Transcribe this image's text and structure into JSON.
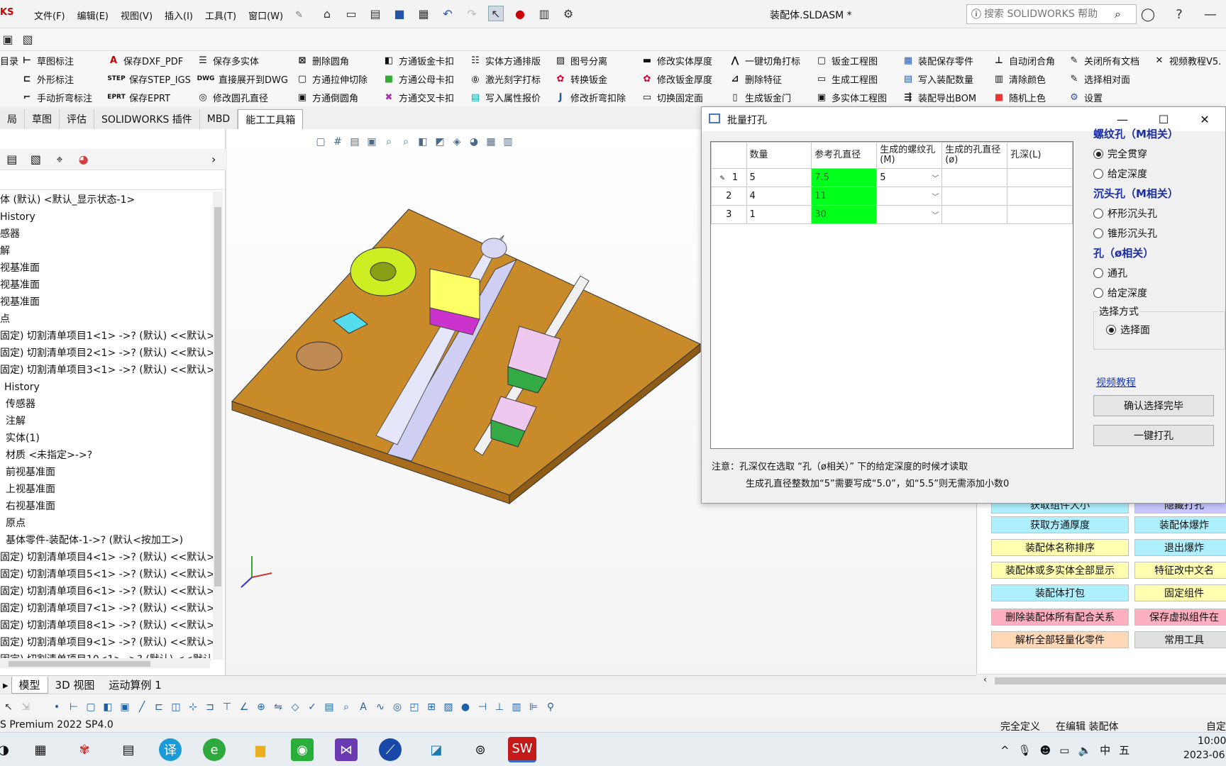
{
  "app": {
    "brand": "KS",
    "menus": [
      "文件(F)",
      "编辑(E)",
      "视图(V)",
      "插入(I)",
      "工具(T)",
      "窗口(W)"
    ],
    "title": "装配体.SLDASM *",
    "search_placeholder": "搜索 SOLIDWORKS 帮助"
  },
  "ribbon": {
    "col1": [
      "目录",
      "",
      ""
    ],
    "col2": [
      "草图标注",
      "外形标注",
      "手动折弯标注"
    ],
    "col3": [
      "保存DXF_PDF",
      "保存STEP_IGS",
      "保存EPRT"
    ],
    "col3_icons": [
      "A",
      "STEP",
      "EPRT"
    ],
    "col4": [
      "保存多实体",
      "直接展开到DWG",
      "修改圆孔直径"
    ],
    "col4_icons": [
      "",
      "DWG",
      ""
    ],
    "col5": [
      "删除圆角",
      "方通拉伸切除",
      "方通倒圆角"
    ],
    "col6": [
      "方通钣金卡扣",
      "方通公母卡扣",
      "方通交叉卡扣"
    ],
    "col7": [
      "实体方通排版",
      "激光刻字打标",
      "写入属性报价"
    ],
    "col8": [
      "图号分离",
      "转换钣金",
      "修改折弯扣除"
    ],
    "col9": [
      "修改实体厚度",
      "修改钣金厚度",
      "切换固定面"
    ],
    "col10": [
      "一键切角打标",
      "删除特征",
      "生成钣金门"
    ],
    "col11": [
      "钣金工程图",
      "生成工程图",
      "多实体工程图"
    ],
    "col12": [
      "装配保存零件",
      "写入装配数量",
      "装配导出BOM"
    ],
    "col13": [
      "自动闭合角",
      "清除颜色",
      "随机上色"
    ],
    "col14": [
      "关闭所有文档",
      "选择相对面",
      "设置"
    ],
    "col15": [
      "视频教程V5.",
      "",
      ""
    ]
  },
  "cmd_tabs": [
    "局",
    "草图",
    "评估",
    "SOLIDWORKS 插件",
    "MBD",
    "能工工具箱"
  ],
  "feature_tree": [
    "体 (默认) <默认_显示状态-1>",
    "History",
    "感器",
    "解",
    "视基准面",
    "视基准面",
    "视基准面",
    "点",
    "固定) 切割清单项目1<1> ->? (默认) <<默认>",
    "固定) 切割清单项目2<1> ->? (默认) <<默认>",
    "固定) 切割清单项目3<1> ->? (默认) <<默认>",
    "History",
    "传感器",
    "注解",
    "实体(1)",
    "材质 <未指定>->?",
    "前视基准面",
    "上视基准面",
    "右视基准面",
    "原点",
    "基体零件-装配体-1->? (默认<按加工>)",
    "固定) 切割清单项目4<1> ->? (默认) <<默认>",
    "固定) 切割清单项目5<1> ->? (默认) <<默认>",
    "固定) 切割清单项目6<1> ->? (默认) <<默认>",
    "固定) 切割清单项目7<1> ->? (默认) <<默认>",
    "固定) 切割清单项目8<1> ->? (默认) <<默认>",
    "固定) 切割清单项目9<1> ->? (默认) <<默认>",
    "固定) 切割清单项目10<1> ->? (默认) <<默认>"
  ],
  "dialog": {
    "title": "批量打孔",
    "columns": [
      "数量",
      "参考孔直径",
      "生成的螺纹孔(M)",
      "生成的孔直径(ø)",
      "孔深(L)"
    ],
    "rows": [
      {
        "n": "1",
        "qty": "5",
        "ref": "7.5",
        "m": "5",
        "d": "",
        "l": ""
      },
      {
        "n": "2",
        "qty": "4",
        "ref": "11",
        "m": "",
        "d": "",
        "l": ""
      },
      {
        "n": "3",
        "qty": "1",
        "ref": "30",
        "m": "",
        "d": "",
        "l": ""
      }
    ],
    "note1": "注意：孔深仅在选取 “孔（ø相关）” 下的给定深度的时候才读取",
    "note2": "生成孔直径整数加“5”需要写成“5.0”，如“5.5”则无需添加小数0",
    "group_thread": "螺纹孔（M相关）",
    "thread_opts": [
      "完全贯穿",
      "给定深度"
    ],
    "group_csink": "沉头孔（M相关）",
    "csink_opts": [
      "杯形沉头孔",
      "锥形沉头孔"
    ],
    "group_hole": "孔（ø相关）",
    "hole_opts": [
      "通孔",
      "给定深度"
    ],
    "select_mode_label": "选择方式",
    "select_face": "选择面",
    "tutorial": "视频教程",
    "confirm_btn": "确认选择完毕",
    "punch_btn": "一键打孔",
    "green": "#00ff1a"
  },
  "tool_panel": {
    "left": [
      "获取组件大小",
      "获取方通厚度",
      "装配体名称排序",
      "装配体或多实体全部显示",
      "装配体打包",
      "删除装配体所有配合关系",
      "解析全部轻量化零件"
    ],
    "left_colors": [
      "#aff0ff",
      "#aff0ff",
      "#ffffb0",
      "#ffffb0",
      "#aff0ff",
      "#ffb0c0",
      "#ffd8b8"
    ],
    "right": [
      "隐藏打孔",
      "装配体爆炸",
      "退出爆炸",
      "特征改中文名",
      "固定组件",
      "保存虚拟组件在",
      "常用工具"
    ],
    "right_colors": [
      "#c8c8ff",
      "#aff0ff",
      "#aff0ff",
      "#ffffb0",
      "#ffffb0",
      "#ffb0c0",
      "#e0e0e0"
    ]
  },
  "bottom_tabs": [
    "模型",
    "3D 视图",
    "运动算例 1"
  ],
  "status": {
    "version": "S Premium 2022 SP4.0",
    "defined": "完全定义",
    "editing": "在编辑 装配体",
    "custom": "自定"
  },
  "taskbar": {
    "time": "10:00",
    "date": "2023-06",
    "ime": "中",
    "ime2": "五"
  }
}
